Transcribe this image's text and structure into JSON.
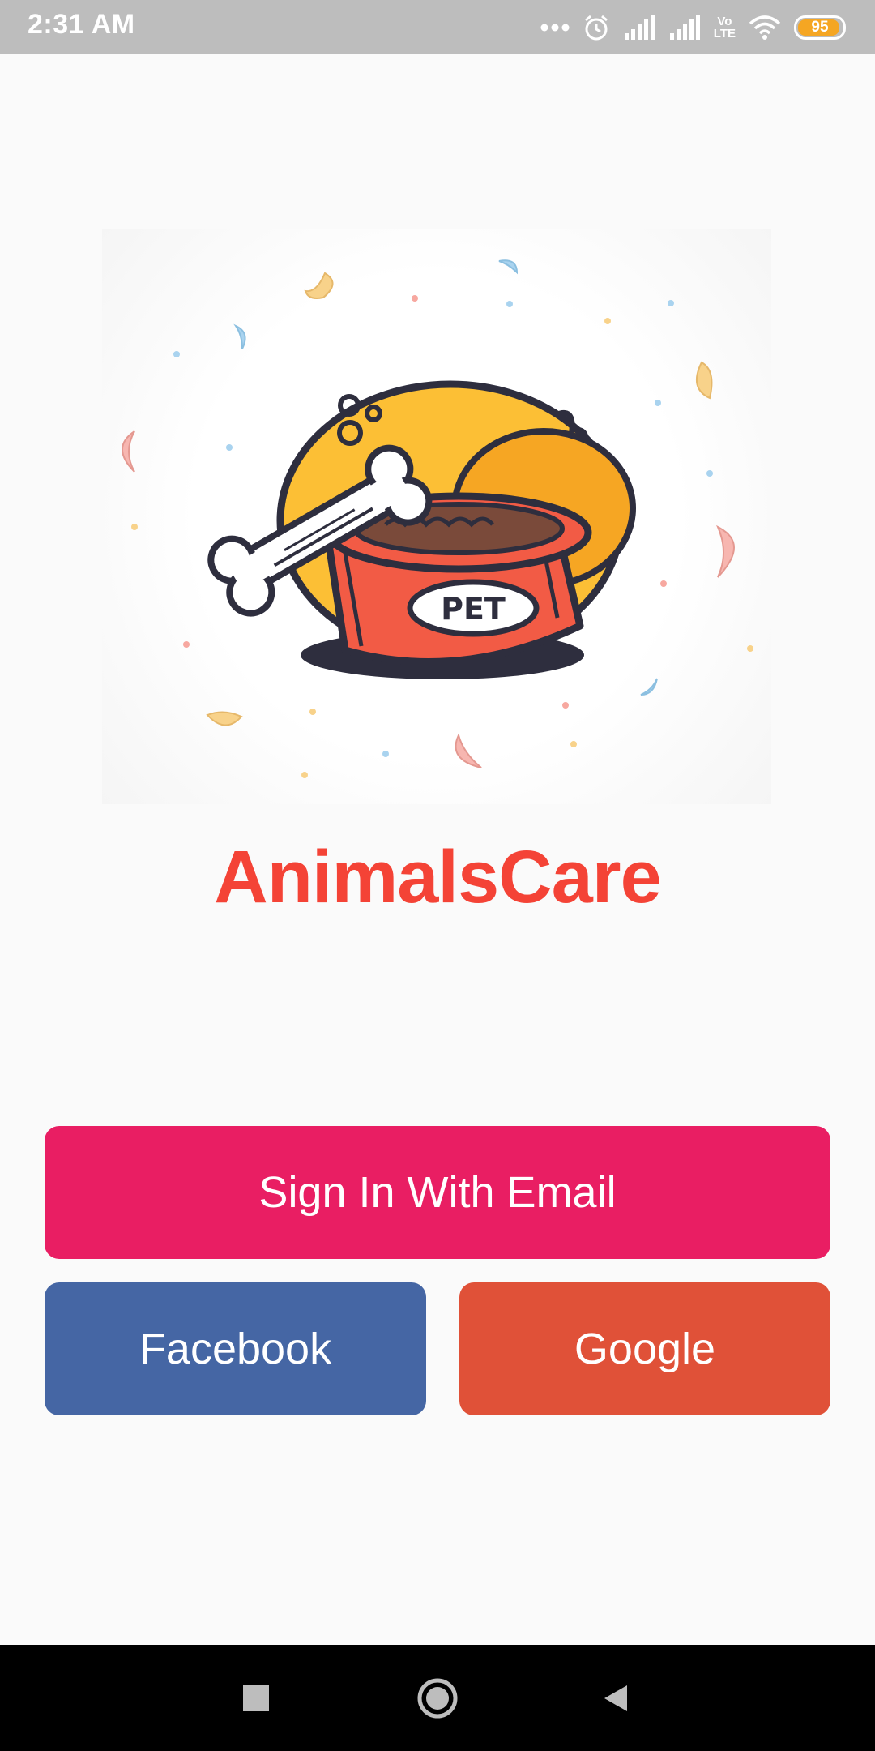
{
  "status_bar": {
    "time": "2:31 AM",
    "network_label_top": "Vo",
    "network_label_bottom": "LTE",
    "battery_level": "95",
    "battery_fraction": 0.95,
    "icons": [
      "more-dots-icon",
      "alarm-icon",
      "signal-icon",
      "signal-icon",
      "volte-icon",
      "wifi-icon",
      "battery-icon"
    ]
  },
  "hero": {
    "image_label": "PET",
    "image_name": "pet-food-bowl-illustration"
  },
  "app": {
    "title": "AnimalsCare"
  },
  "buttons": {
    "email": "Sign In With Email",
    "facebook": "Facebook",
    "google": "Google"
  },
  "nav": {
    "icons": [
      "recents-square-icon",
      "home-circle-icon",
      "back-triangle-icon"
    ]
  },
  "colors": {
    "status_bar": "#bdbdbd",
    "title": "#f44336",
    "email_button": "#e91e63",
    "facebook_button": "#4566a4",
    "google_button": "#e05138",
    "nav_bar": "#000000"
  }
}
